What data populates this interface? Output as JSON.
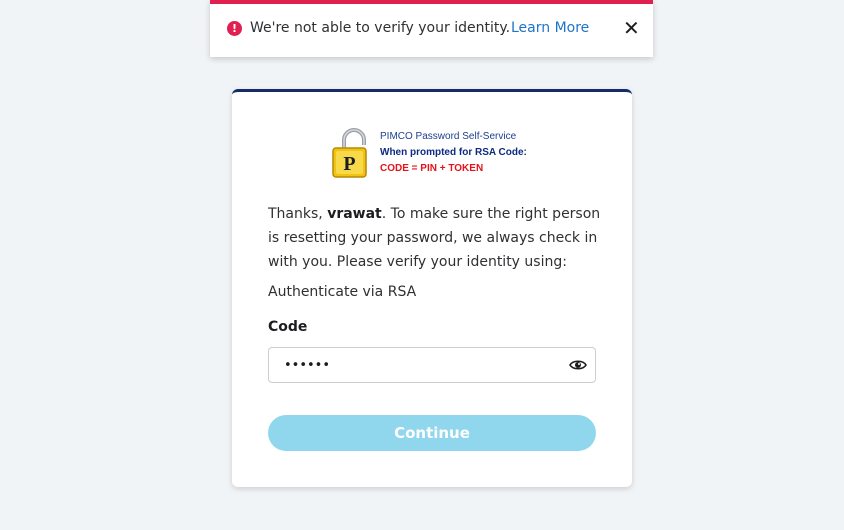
{
  "banner": {
    "icon": "alert-circle-icon",
    "icon_glyph": "!",
    "message": "We're not able to verify your identity.",
    "link_text": "Learn More",
    "close_icon": "close-icon",
    "close_glyph": "✕",
    "accent_color": "#e0204e"
  },
  "card": {
    "logo": {
      "icon": "padlock-p-icon",
      "line1": "PIMCO Password Self-Service",
      "line2": "When prompted for RSA Code:",
      "line3": "CODE = PIN + TOKEN"
    },
    "intro": {
      "prefix": "Thanks, ",
      "username": "vrawat",
      "suffix": ". To make sure the right person is resetting your password, we always check in with you. Please verify your identity using:"
    },
    "method": "Authenticate via RSA",
    "code": {
      "label": "Code",
      "value": "••••••",
      "type": "password",
      "toggle_icon": "eye-icon"
    },
    "continue_label": "Continue",
    "border_top_color": "#162b6a",
    "button_color": "#90d7ee"
  }
}
